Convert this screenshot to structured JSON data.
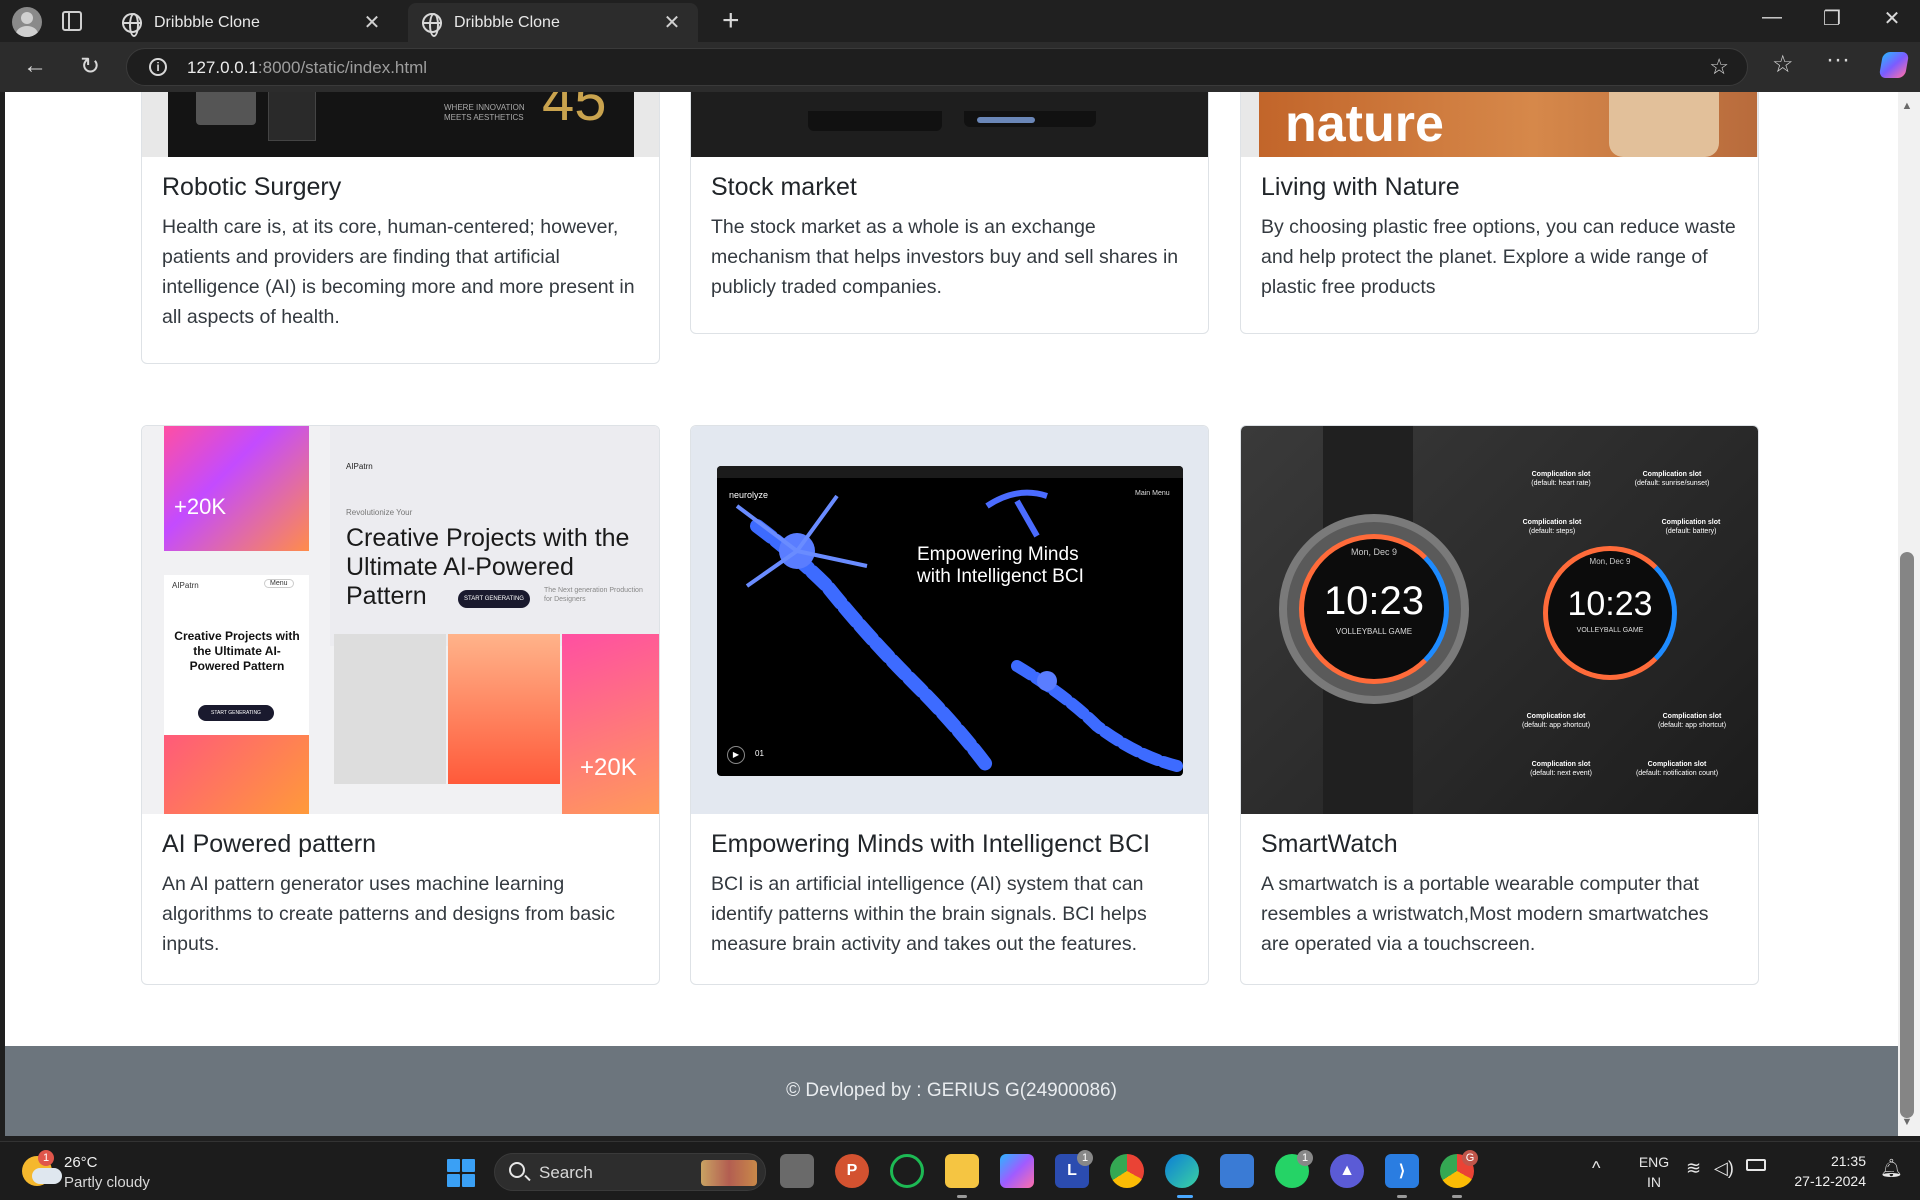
{
  "browser": {
    "tabs": [
      {
        "title": "Dribbble Clone"
      },
      {
        "title": "Dribbble Clone"
      }
    ],
    "url_host": "127.0.0.1",
    "url_rest": ":8000/static/index.html"
  },
  "cards_top": [
    {
      "title": "Robotic Surgery",
      "text": "Health care is, at its core, human-centered; however, patients and providers are finding that artificial intelligence (AI) is becoming more and more present in all aspects of health.",
      "img_text1": "WHERE INNOVATION MEETS AESTHETICS",
      "img_text2": "45"
    },
    {
      "title": "Stock market",
      "text": "The stock market as a whole is an exchange mechanism that helps investors buy and sell shares in publicly traded companies."
    },
    {
      "title": "Living with Nature",
      "text": "By choosing plastic free options, you can reduce waste and help protect the planet. Explore a wide range of plastic free products",
      "img_text": "nature"
    }
  ],
  "cards_bottom": [
    {
      "title": "AI Powered pattern",
      "text": "An AI pattern generator uses machine learning algorithms to create patterns and designs from basic inputs.",
      "img": {
        "brand": "AIPatrn",
        "tagline": "Revolutionize Your",
        "headline": "Creative Projects with the Ultimate AI-Powered Pattern",
        "cta": "START GENERATING",
        "stat": "+20K",
        "sub": "The Next generation Production for Designers",
        "menu": "Menu"
      }
    },
    {
      "title": "Empowering Minds with Intelligenct BCI",
      "text": "BCI is an artificial intelligence (AI) system that can identify patterns within the brain signals. BCI helps measure brain activity and takes out the features.",
      "img": {
        "brand": "neurolyze",
        "headline": "Empowering Minds with Intelligenct BCI",
        "nav": "Main Menu",
        "counter": "01"
      }
    },
    {
      "title": "SmartWatch",
      "text": "A smartwatch is a portable wearable computer that resembles a wristwatch,Most modern smartwatches are operated via a touchscreen.",
      "img": {
        "time": "10:23",
        "date": "Mon, Dec 9",
        "event": "VOLLEYBALL GAME",
        "slot": "Complication slot",
        "slots": [
          "(default: heart rate)",
          "(default: sunrise/sunset)",
          "(default: steps)",
          "(default: battery)",
          "(default: app shortcut)",
          "(default: app shortcut)",
          "(default: next event)",
          "(default: notification count)"
        ]
      }
    }
  ],
  "footer": {
    "text": "© Devloped by : GERIUS G(24900086)"
  },
  "taskbar": {
    "weather_temp": "26°C",
    "weather_desc": "Partly cloudy",
    "weather_badge": "1",
    "search_label": "Search",
    "lang1": "ENG",
    "lang2": "IN",
    "time": "21:35",
    "date": "27-12-2024",
    "lync_badge": "1",
    "whatsapp_badge": "1",
    "chrome_badge": "G"
  }
}
